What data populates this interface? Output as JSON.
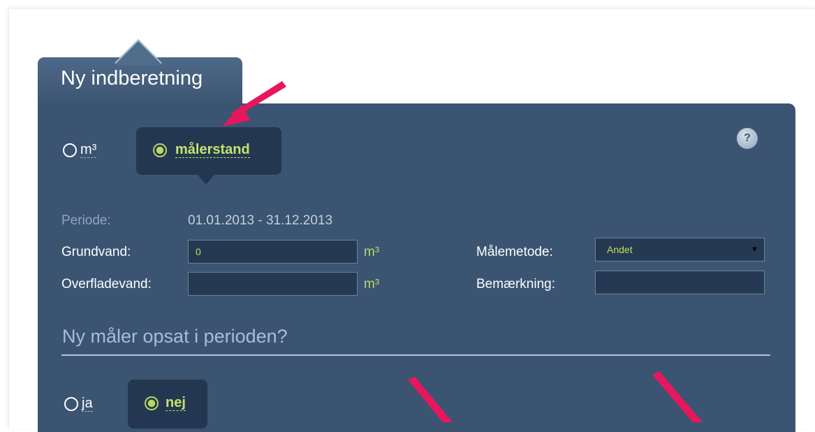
{
  "tab": {
    "title": "Ny indberetning"
  },
  "unit_toggle": {
    "options": [
      "m³",
      "målerstand"
    ],
    "selected": "målerstand"
  },
  "help": {
    "label": "?"
  },
  "form": {
    "period_label": "Periode:",
    "period_value": "01.01.2013 - 31.12.2013",
    "grundvand_label": "Grundvand:",
    "grundvand_value": "0",
    "grundvand_unit": "m³",
    "overfladevand_label": "Overfladevand:",
    "overfladevand_value": "",
    "overfladevand_unit": "m³",
    "maalemetode_label": "Målemetode:",
    "maalemetode_value": "Andet",
    "bemaerkning_label": "Bemærkning:",
    "bemaerkning_value": ""
  },
  "new_meter": {
    "title": "Ny måler opsat i perioden?",
    "options": [
      "ja",
      "nej"
    ],
    "selected": "nej"
  },
  "colors": {
    "panel": "#3b5472",
    "accent": "#c5dd58",
    "annotation_arrow": "#e8175d"
  }
}
